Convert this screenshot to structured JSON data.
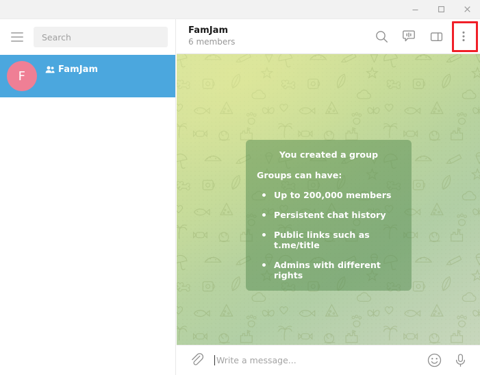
{
  "window": {
    "minimize_label": "Minimize",
    "maximize_label": "Maximize",
    "close_label": "Close"
  },
  "sidebar": {
    "menu_icon": "hamburger-menu-icon",
    "search": {
      "placeholder": "Search",
      "value": ""
    },
    "chats": [
      {
        "avatar_letter": "F",
        "avatar_color": "#ef7f95",
        "title": "FamJam",
        "is_group": true,
        "selected": true,
        "selected_color": "#4ba7de"
      }
    ]
  },
  "chat_header": {
    "title": "FamJam",
    "subtitle": "6 members",
    "actions": [
      {
        "name": "search-icon",
        "label": "Search Messages"
      },
      {
        "name": "video-chat-icon",
        "label": "Video Chat"
      },
      {
        "name": "panel-toggle-icon",
        "label": "Toggle Info Panel"
      },
      {
        "name": "more-options-icon",
        "label": "More Options",
        "highlighted": true,
        "highlight_color": "#f01f28"
      }
    ]
  },
  "chat": {
    "background": {
      "pattern": "telegram-doodle-pattern",
      "top_color": "#dae5a3",
      "bottom_color": "#c8d7bd"
    },
    "service_message": {
      "title": "You created a group",
      "lead": "Groups can have:",
      "items": [
        "Up to 200,000 members",
        "Persistent chat history",
        "Public links such as t.me/title",
        "Admins with different rights"
      ]
    }
  },
  "composer": {
    "attach_icon": "paperclip-icon",
    "input": {
      "placeholder": "Write a message...",
      "value": ""
    },
    "emoji_icon": "smiley-icon",
    "voice_icon": "microphone-icon"
  }
}
